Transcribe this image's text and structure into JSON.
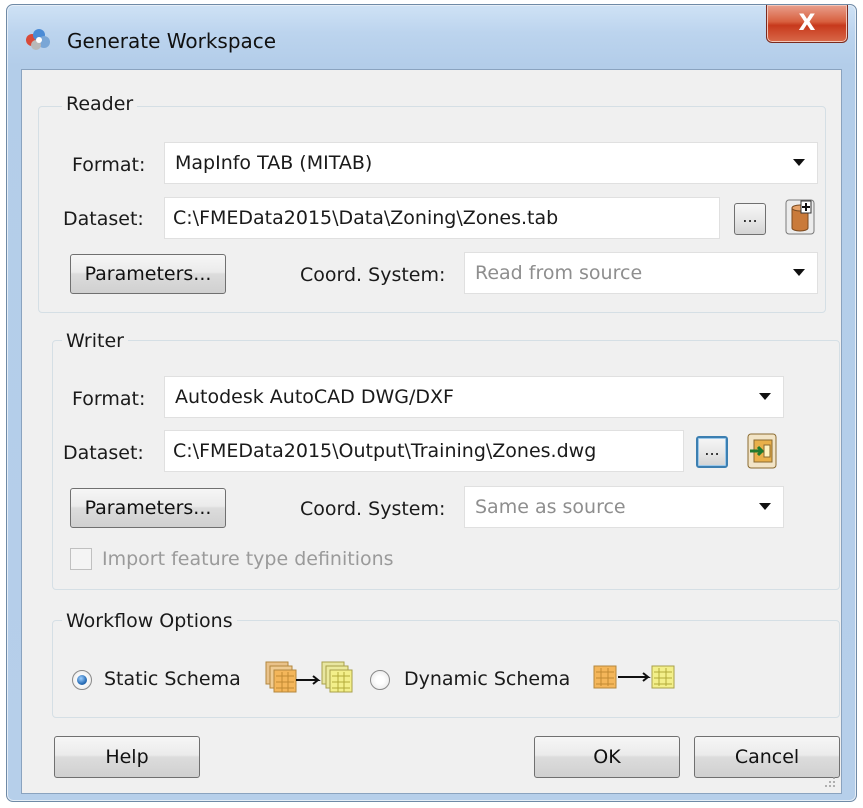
{
  "window": {
    "title": "Generate Workspace",
    "close_label": "X"
  },
  "reader": {
    "group_label": "Reader",
    "format_label": "Format:",
    "format_value": "MapInfo TAB (MITAB)",
    "dataset_label": "Dataset:",
    "dataset_value": "C:\\FMEData2015\\Data\\Zoning\\Zones.tab",
    "browse_label": "...",
    "parameters_label": "Parameters...",
    "coord_label": "Coord. System:",
    "coord_value": "Read from source"
  },
  "writer": {
    "group_label": "Writer",
    "format_label": "Format:",
    "format_value": "Autodesk AutoCAD DWG/DXF",
    "dataset_label": "Dataset:",
    "dataset_value": "C:\\FMEData2015\\Output\\Training\\Zones.dwg",
    "browse_label": "...",
    "parameters_label": "Parameters...",
    "coord_label": "Coord. System:",
    "coord_value": "Same as source",
    "import_label": "Import feature type definitions"
  },
  "workflow": {
    "group_label": "Workflow Options",
    "static_label": "Static Schema",
    "dynamic_label": "Dynamic Schema",
    "selected": "Static Schema"
  },
  "buttons": {
    "help": "Help",
    "ok": "OK",
    "cancel": "Cancel"
  },
  "colors": {
    "accent": "#3c7fb1",
    "close": "#c7391c"
  }
}
